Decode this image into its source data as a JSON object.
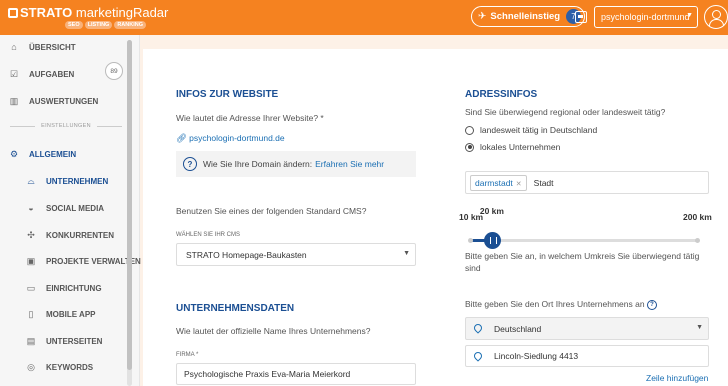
{
  "app": {
    "brand": "STRATO",
    "product": "marketingRadar",
    "badges": [
      "SEO",
      "LISTING",
      "RANKING"
    ]
  },
  "topbar": {
    "quickstart_label": "Schnelleinstieg",
    "quickstart_count": "7",
    "project": "psychologin-dortmund"
  },
  "sidebar": {
    "items": [
      {
        "label": "ÜBERSICHT",
        "icon": "home-icon"
      },
      {
        "label": "AUFGABEN",
        "icon": "checkbox-icon",
        "count": "89"
      },
      {
        "label": "AUSWERTUNGEN",
        "icon": "bar-chart-icon"
      }
    ],
    "settings_divider": "EINSTELLUNGEN",
    "settings": {
      "label": "ALLGEMEIN",
      "icon": "gear-icon"
    },
    "subitems": [
      {
        "label": "UNTERNEHMEN",
        "icon": "shop-icon",
        "active": true
      },
      {
        "label": "SOCIAL MEDIA",
        "icon": "globe-icon"
      },
      {
        "label": "KONKURRENTEN",
        "icon": "lightbulb-icon"
      },
      {
        "label": "PROJEKTE VERWALTEN",
        "icon": "folder-icon"
      },
      {
        "label": "EINRICHTUNG",
        "icon": "monitor-icon"
      },
      {
        "label": "MOBILE APP",
        "icon": "phone-icon"
      },
      {
        "label": "UNTERSEITEN",
        "icon": "pages-icon"
      },
      {
        "label": "KEYWORDS",
        "icon": "tag-icon"
      }
    ]
  },
  "website": {
    "heading": "INFOS ZUR WEBSITE",
    "question": "Wie lautet die Adresse Ihrer Website? *",
    "url": "psychologin-dortmund.de",
    "info_text": "Wie Sie Ihre Domain ändern:",
    "info_link": "Erfahren Sie mehr",
    "cms_question": "Benutzen Sie eines der folgenden Standard CMS?",
    "cms_label": "WÄHLEN SIE IHR CMS",
    "cms_value": "STRATO Homepage-Baukasten"
  },
  "company": {
    "heading": "UNTERNEHMENSDATEN",
    "question": "Wie lautet der offizielle Name Ihres Unternehmens?",
    "firma_label": "FIRMA *",
    "firma_value": "Psychologische Praxis Eva-Maria Meierkord"
  },
  "address": {
    "heading": "ADRESSINFOS",
    "question": "Sind Sie überwiegend regional oder landesweit tätig?",
    "option_national": "landesweit tätig in Deutschland",
    "option_local": "lokales Unternehmen",
    "tag": "darmstadt",
    "tag_input_placeholder": "Stadt",
    "range_min_label": "10 km",
    "range_value_label": "20 km",
    "range_max_label": "200 km",
    "radius_km": 20,
    "radius_min_km": 10,
    "radius_max_km": 200,
    "radius_hint": "Bitte geben Sie an, in welchem Umkreis Sie überwiegend tätig sind",
    "location_question": "Bitte geben Sie den Ort Ihres Unternehmens an",
    "country": "Deutschland",
    "street": "Lincoln-Siedlung 4413",
    "add_line": "Zeile hinzufügen"
  },
  "colors": {
    "accent": "#f58220",
    "primary": "#1b4f93",
    "link": "#1b6fb3"
  }
}
